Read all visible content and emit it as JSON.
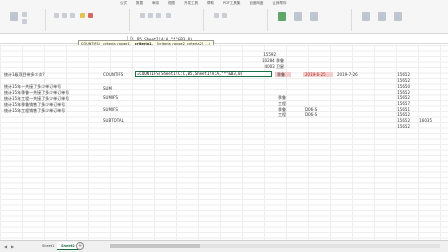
{
  "menu": {
    "tabs": [
      "公式",
      "数据",
      "审阅",
      "视图",
      "开发工具",
      "帮助",
      "PDF工具集",
      "百度网盘",
      "让我帮你"
    ]
  },
  "formula_bar": {
    "name_box": "",
    "fx": "fx",
    "formula": "B5,Sheet1!A:A,\"*\"&B3,0)"
  },
  "tooltip": {
    "func": "COUNTIFS(",
    "args": [
      "criteria_range1,",
      "criteria1,",
      "[criteria_range2, criteria2], ...)"
    ]
  },
  "cells": {
    "header_numbers": [
      "15592",
      "10284 季鲁",
      "4003 卫星"
    ],
    "edit_formula": "=COUNTIFS(Sheet1!C:C,B5,Sheet1!A:A,\"*\"&B3,0)",
    "pink_label": "季鲁",
    "pink_date": "2019-6-25",
    "date2": "2019-7-26",
    "row_a3": "统计1级项目带多少次?",
    "row_b3": "COUNTIFS",
    "questions": [
      "统计15年一共接了多少单订单号",
      "统计15年季鲁一共接了多少单订单号",
      "统计15年工程一共接了多少单订单号",
      "统计15年季鲁销售了多少单订单号",
      "统计15年工程销售了多少单订单号"
    ],
    "funcs": [
      "SUM",
      "SUMIFS",
      "",
      "SUMIFS",
      "SUBTOTAL"
    ],
    "names": [
      "",
      "季鲁",
      "工程",
      "季鲁",
      "工程"
    ],
    "codes": [
      "",
      "",
      "",
      "D06-S",
      "D06-S"
    ],
    "right_col": [
      "15652",
      "15652",
      "15650",
      "15652",
      "15652",
      "15657",
      "15651",
      "15652",
      "15652",
      "15652"
    ],
    "far_right": "16035"
  },
  "sheets": {
    "tabs": [
      "Sheet1",
      "Sheet2"
    ],
    "active": "Sheet2",
    "add": "+"
  }
}
